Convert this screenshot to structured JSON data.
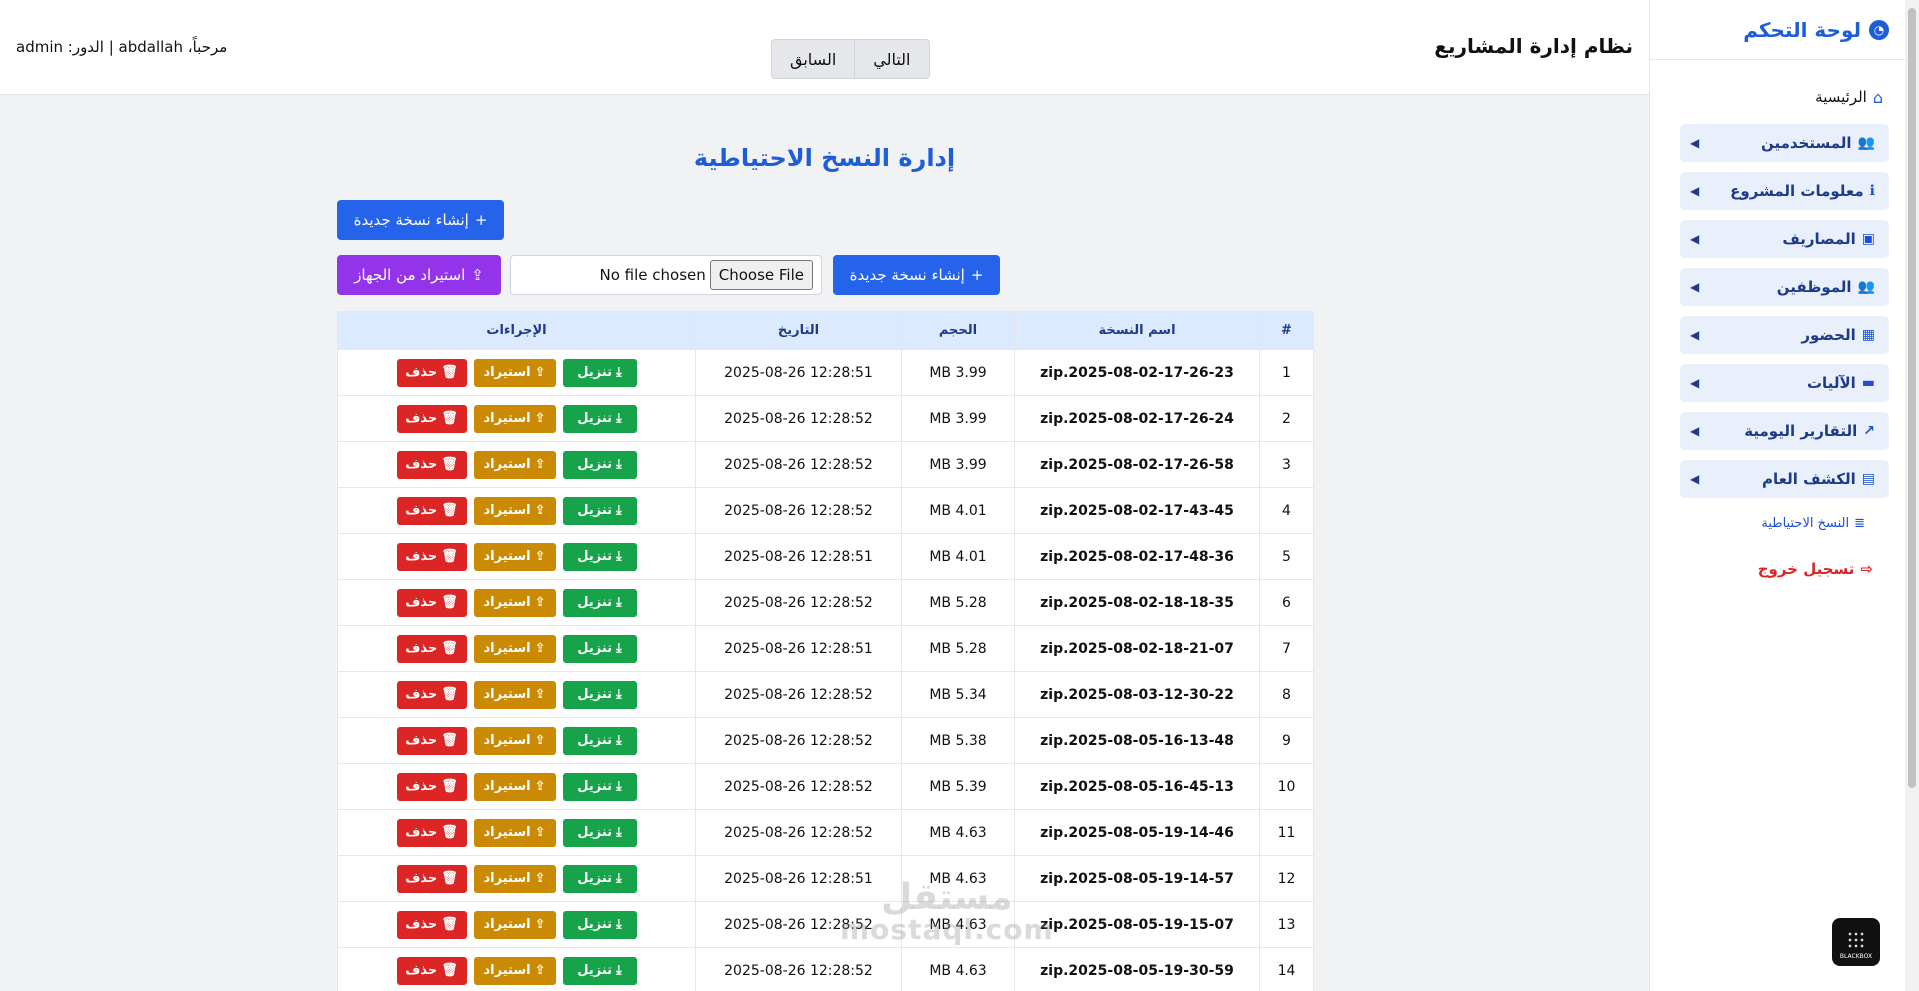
{
  "sidebar": {
    "brand": "لوحة التحكم",
    "home": "الرئيسية",
    "groups": [
      {
        "label": "المستخدمين",
        "icon": "users-icon"
      },
      {
        "label": "معلومات المشروع",
        "icon": "info-icon"
      },
      {
        "label": "المصاريف",
        "icon": "money-icon"
      },
      {
        "label": "الموظفين",
        "icon": "users-icon"
      },
      {
        "label": "الحضور",
        "icon": "calendar-check-icon"
      },
      {
        "label": "الآليات",
        "icon": "truck-icon"
      },
      {
        "label": "التقارير اليومية",
        "icon": "chart-line-icon"
      },
      {
        "label": "الكشف العام",
        "icon": "file-invoice-icon"
      }
    ],
    "backups": "النسخ الاحتياطية",
    "logout": "تسجيل خروج"
  },
  "topbar": {
    "app_title": "نظام إدارة المشاريع",
    "welcome": "مرحباً، abdallah | الدور: admin",
    "next": "التالي",
    "prev": "السابق"
  },
  "main": {
    "title": "إدارة النسخ الاحتياطية",
    "create_backup": "إنشاء نسخة جديدة",
    "create_backup_2": "إنشاء نسخة جديدة",
    "restore_from_device": "استيراد من الجهاز",
    "choose_file": "Choose File",
    "file_status": "No file chosen"
  },
  "table": {
    "headers": {
      "num": "#",
      "name": "اسم النسخة",
      "size": "الحجم",
      "date": "التاريخ",
      "actions": "الإجراءات"
    },
    "actions": {
      "download": "تنزيل",
      "restore": "استيراد",
      "delete": "حذف"
    },
    "rows": [
      {
        "num": "1",
        "name": "zip.2025-08-02-17-26-23",
        "size": "MB 3.99",
        "date": "2025-08-26 12:28:51"
      },
      {
        "num": "2",
        "name": "zip.2025-08-02-17-26-24",
        "size": "MB 3.99",
        "date": "2025-08-26 12:28:52"
      },
      {
        "num": "3",
        "name": "zip.2025-08-02-17-26-58",
        "size": "MB 3.99",
        "date": "2025-08-26 12:28:52"
      },
      {
        "num": "4",
        "name": "zip.2025-08-02-17-43-45",
        "size": "MB 4.01",
        "date": "2025-08-26 12:28:52"
      },
      {
        "num": "5",
        "name": "zip.2025-08-02-17-48-36",
        "size": "MB 4.01",
        "date": "2025-08-26 12:28:51"
      },
      {
        "num": "6",
        "name": "zip.2025-08-02-18-18-35",
        "size": "MB 5.28",
        "date": "2025-08-26 12:28:52"
      },
      {
        "num": "7",
        "name": "zip.2025-08-02-18-21-07",
        "size": "MB 5.28",
        "date": "2025-08-26 12:28:51"
      },
      {
        "num": "8",
        "name": "zip.2025-08-03-12-30-22",
        "size": "MB 5.34",
        "date": "2025-08-26 12:28:52"
      },
      {
        "num": "9",
        "name": "zip.2025-08-05-16-13-48",
        "size": "MB 5.38",
        "date": "2025-08-26 12:28:52"
      },
      {
        "num": "10",
        "name": "zip.2025-08-05-16-45-13",
        "size": "MB 5.39",
        "date": "2025-08-26 12:28:52"
      },
      {
        "num": "11",
        "name": "zip.2025-08-05-19-14-46",
        "size": "MB 4.63",
        "date": "2025-08-26 12:28:52"
      },
      {
        "num": "12",
        "name": "zip.2025-08-05-19-14-57",
        "size": "MB 4.63",
        "date": "2025-08-26 12:28:51"
      },
      {
        "num": "13",
        "name": "zip.2025-08-05-19-15-07",
        "size": "MB 4.63",
        "date": "2025-08-26 12:28:52"
      },
      {
        "num": "14",
        "name": "zip.2025-08-05-19-30-59",
        "size": "MB 4.63",
        "date": "2025-08-26 12:28:52"
      }
    ]
  },
  "watermark": {
    "arabic": "مستقل",
    "latin": "mostaql.com"
  },
  "badge": {
    "text": "BLACKBOX"
  }
}
